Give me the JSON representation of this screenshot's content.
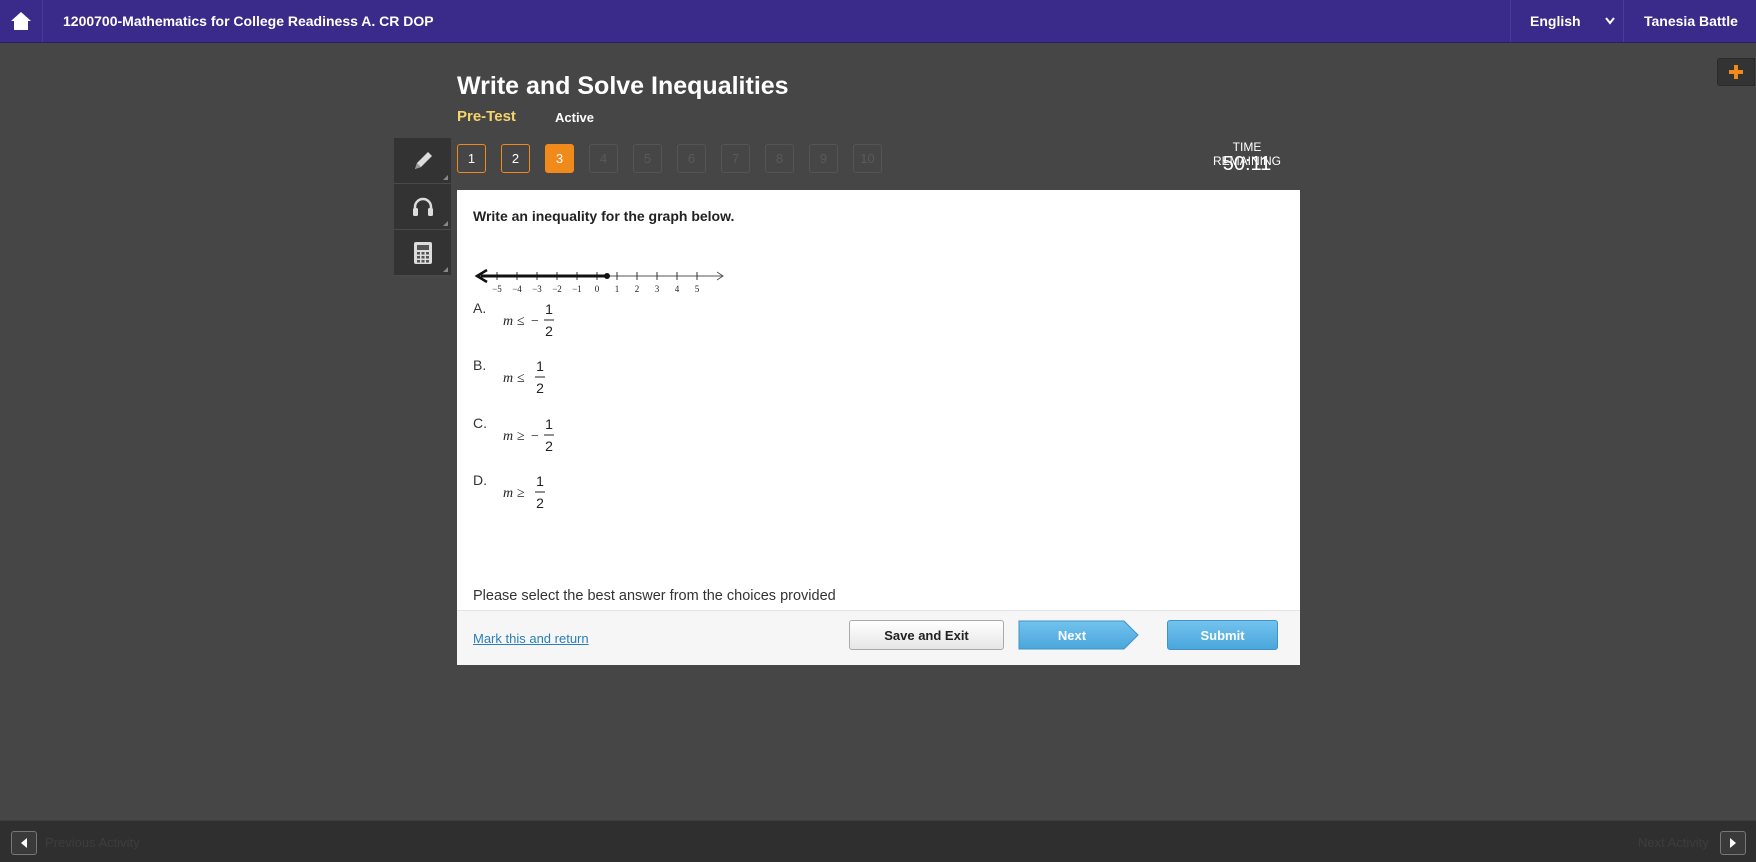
{
  "topbar": {
    "course_title": "1200700-Mathematics for College Readiness A. CR DOP",
    "language": "English",
    "user_name": "Tanesia Battle"
  },
  "header": {
    "title": "Write and Solve Inequalities",
    "subtitle": "Pre-Test",
    "status": "Active"
  },
  "question_nav": {
    "items": [
      "1",
      "2",
      "3",
      "4",
      "5",
      "6",
      "7",
      "8",
      "9",
      "10"
    ],
    "answered": [
      "1",
      "2"
    ],
    "current": "3"
  },
  "timer": {
    "label": "TIME REMAINING",
    "value": "50:11"
  },
  "question": {
    "prompt": "Write an inequality for the graph below.",
    "number_line": {
      "ticks": [
        "−5",
        "−4",
        "−3",
        "−2",
        "−1",
        "0",
        "1",
        "2",
        "3",
        "4",
        "5"
      ],
      "endpoint": "1/2",
      "endpoint_type": "closed",
      "direction": "left"
    },
    "choices": [
      {
        "letter": "A.",
        "variable": "m",
        "operator": "≤",
        "sign": "−",
        "numerator": "1",
        "denominator": "2"
      },
      {
        "letter": "B.",
        "variable": "m",
        "operator": "≤",
        "sign": "",
        "numerator": "1",
        "denominator": "2"
      },
      {
        "letter": "C.",
        "variable": "m",
        "operator": "≥",
        "sign": "−",
        "numerator": "1",
        "denominator": "2"
      },
      {
        "letter": "D.",
        "variable": "m",
        "operator": "≥",
        "sign": "",
        "numerator": "1",
        "denominator": "2"
      }
    ],
    "instruction": "Please select the best answer from the choices provided"
  },
  "footer": {
    "mark_link": "Mark this and return",
    "save_label": "Save and Exit",
    "next_label": "Next",
    "submit_label": "Submit"
  },
  "bottombar": {
    "previous_label": "Previous Activity",
    "next_label": "Next Activity"
  },
  "colors": {
    "topbar": "#3a2a8a",
    "accent_orange": "#f08a1a",
    "button_blue": "#4aa6dc",
    "pretest_yellow": "#f4d56a"
  },
  "icons": [
    "home-icon",
    "chevron-down-icon",
    "plus-icon",
    "pencil-icon",
    "headphones-icon",
    "calculator-icon",
    "caret-left-icon",
    "caret-right-icon"
  ]
}
